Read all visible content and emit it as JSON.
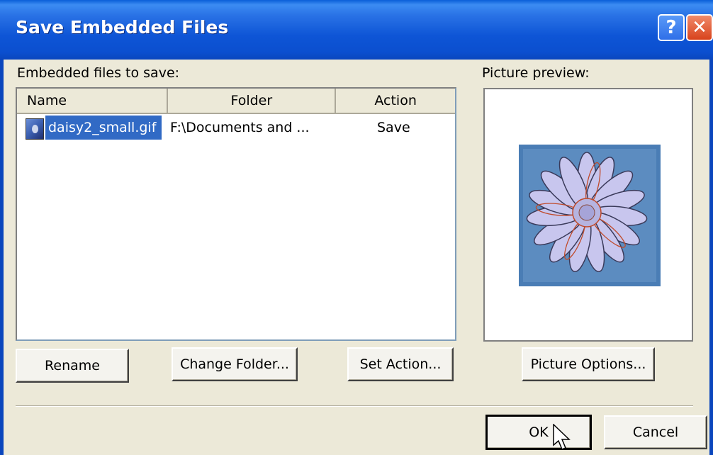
{
  "window": {
    "title": "Save Embedded Files",
    "help_glyph": "?",
    "close_glyph": "✕"
  },
  "list": {
    "label": "Embedded files to save:",
    "columns": [
      "Name",
      "Folder",
      "Action"
    ],
    "rows": [
      {
        "name": "daisy2_small.gif",
        "folder": "F:\\Documents and ...",
        "action": "Save",
        "selected": true
      }
    ]
  },
  "preview": {
    "label": "Picture preview:",
    "image": "daisy flower thumbnail"
  },
  "buttons": {
    "rename": "Rename",
    "change_folder": "Change Folder...",
    "set_action": "Set Action...",
    "picture_options": "Picture Options...",
    "ok": "OK",
    "cancel": "Cancel"
  },
  "colors": {
    "titlebar": "#0a5fd8",
    "selection": "#316ac5",
    "dialog_bg": "#ece9d8"
  }
}
